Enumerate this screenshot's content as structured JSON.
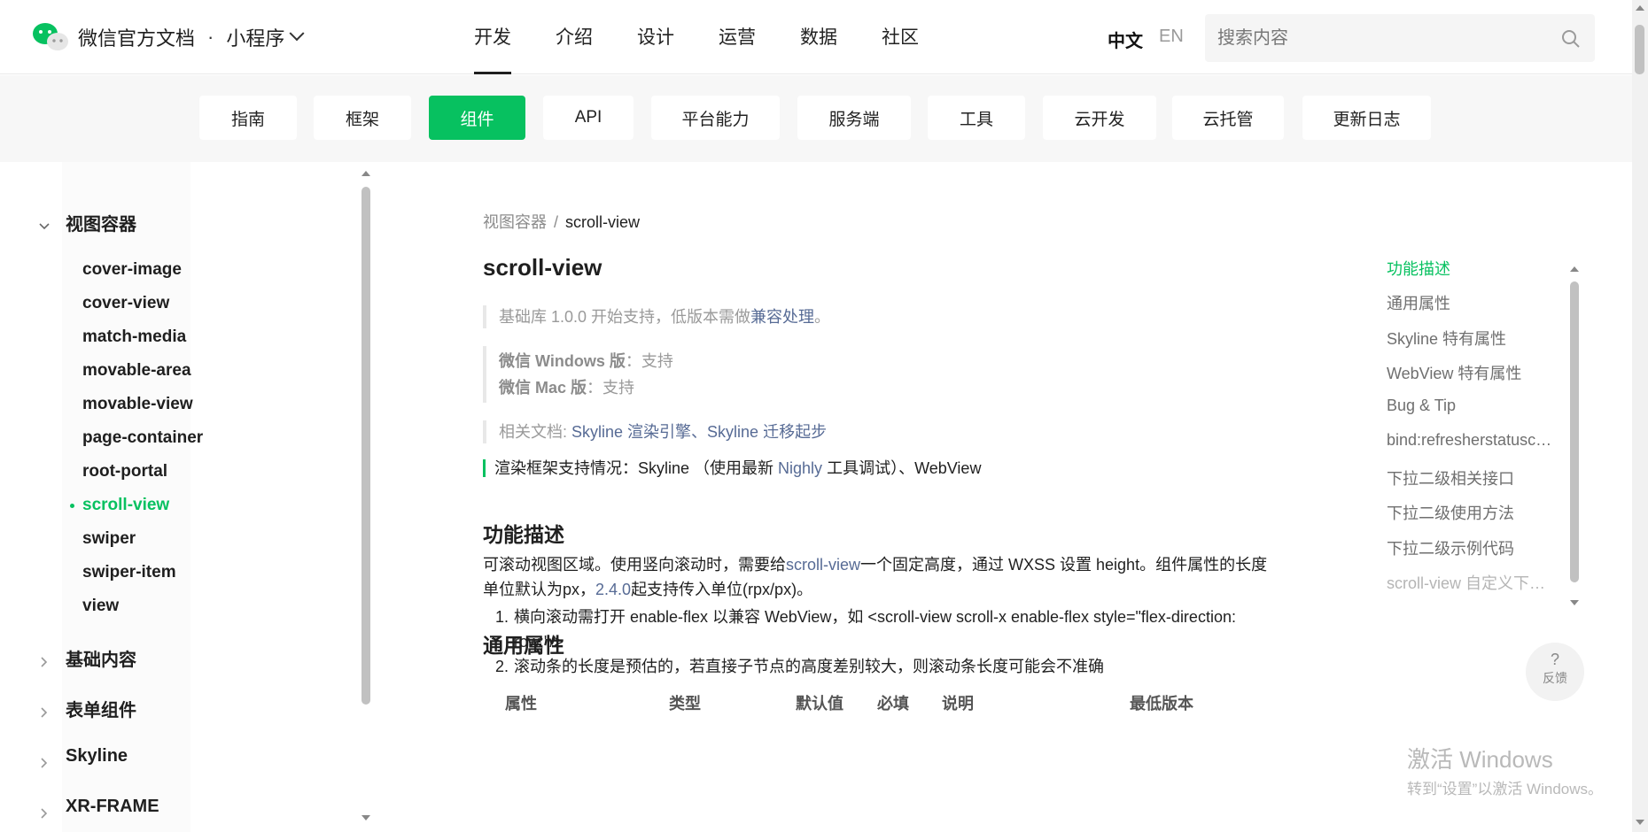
{
  "brand": {
    "title": "微信官方文档",
    "dot": "·",
    "product": "小程序"
  },
  "main_nav": [
    {
      "label": "开发",
      "active": true
    },
    {
      "label": "介绍",
      "active": false
    },
    {
      "label": "设计",
      "active": false
    },
    {
      "label": "运营",
      "active": false
    },
    {
      "label": "数据",
      "active": false
    },
    {
      "label": "社区",
      "active": false
    }
  ],
  "lang": {
    "zh": "中文",
    "en": "EN"
  },
  "search": {
    "placeholder": "搜索内容"
  },
  "sub_nav": [
    {
      "label": "指南",
      "active": false
    },
    {
      "label": "框架",
      "active": false
    },
    {
      "label": "组件",
      "active": true
    },
    {
      "label": "API",
      "active": false
    },
    {
      "label": "平台能力",
      "active": false
    },
    {
      "label": "服务端",
      "active": false
    },
    {
      "label": "工具",
      "active": false
    },
    {
      "label": "云开发",
      "active": false
    },
    {
      "label": "云托管",
      "active": false
    },
    {
      "label": "更新日志",
      "active": false
    }
  ],
  "sidebar": {
    "groups": [
      {
        "label": "视图容器",
        "expanded": true
      },
      {
        "label": "基础内容",
        "expanded": false
      },
      {
        "label": "表单组件",
        "expanded": false
      },
      {
        "label": "Skyline",
        "expanded": false
      },
      {
        "label": "XR-FRAME",
        "expanded": false
      }
    ],
    "items": [
      "cover-image",
      "cover-view",
      "match-media",
      "movable-area",
      "movable-view",
      "page-container",
      "root-portal",
      "scroll-view",
      "swiper",
      "swiper-item",
      "view"
    ],
    "active_item": "scroll-view"
  },
  "breadcrumb": {
    "parent": "视图容器",
    "sep": "/",
    "current": "scroll-view"
  },
  "page_title": "scroll-view",
  "support": {
    "base_prefix": "基础库 1.0.0 开始支持，低版本需做",
    "base_link": "兼容处理",
    "base_suffix": "。",
    "windows_label": "微信 Windows 版",
    "windows_value": "：支持",
    "mac_label": "微信 Mac 版",
    "mac_value": "：支持",
    "related_prefix": "相关文档: ",
    "related_link1": "Skyline 渲染引擎",
    "related_sep": "、",
    "related_link2": "Skyline 迁移起步"
  },
  "render": {
    "prefix": "渲染框架支持情况：Skyline （使用最新 ",
    "link": "Nighly",
    "suffix": " 工具调试）、WebView"
  },
  "section1": {
    "title": "功能描述",
    "p_a": "可滚动视图区域。使用竖向滚动时，需要给",
    "p_link1": "scroll-view",
    "p_b": "一个固定高度，通过 WXSS 设置 height。组件属性的长度单位默认为px，",
    "p_link2": "2.4.0",
    "p_c": "起支持传入单位(rpx/px)。",
    "list": [
      "横向滚动需打开 enable-flex 以兼容 WebView，如 <scroll-view scroll-x enable-flex style=\"flex-direction: row;\"/>",
      "滚动条的长度是预估的，若直接子节点的高度差别较大，则滚动条长度可能会不准确"
    ]
  },
  "section2": {
    "title": "通用属性",
    "columns": [
      "属性",
      "类型",
      "默认值",
      "必填",
      "说明",
      "最低版本"
    ]
  },
  "toc": [
    {
      "label": "功能描述",
      "state": "active"
    },
    {
      "label": "通用属性",
      "state": "normal"
    },
    {
      "label": "Skyline 特有属性",
      "state": "normal"
    },
    {
      "label": "WebView 特有属性",
      "state": "normal"
    },
    {
      "label": "Bug & Tip",
      "state": "normal"
    },
    {
      "label": "bind:refresherstatuschange",
      "state": "normal"
    },
    {
      "label": "下拉二级相关接口",
      "state": "normal"
    },
    {
      "label": "下拉二级使用方法",
      "state": "normal"
    },
    {
      "label": "下拉二级示例代码",
      "state": "normal"
    },
    {
      "label": "scroll-view 自定义下拉刷新",
      "state": "faded"
    }
  ],
  "feedback": {
    "icon": "?",
    "label": "反馈"
  },
  "watermark": {
    "line1": "激活 Windows",
    "line2": "转到“设置”以激活 Windows。"
  },
  "colors": {
    "accent": "#07c160",
    "link": "#576b95"
  }
}
